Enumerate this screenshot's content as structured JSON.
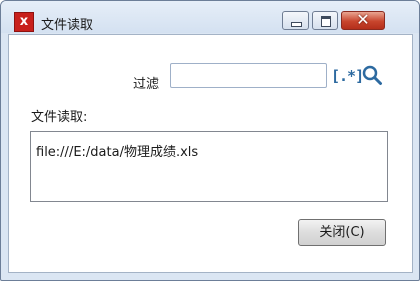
{
  "window": {
    "title": "文件读取",
    "app_icon_glyph": "ⅹ",
    "controls": {
      "minimize": "minimize",
      "maximize": "maximize",
      "close": "✕"
    }
  },
  "filter": {
    "label": "过滤",
    "value": "",
    "regex_icon_text": "[.*]",
    "search_icon": "search-icon"
  },
  "content": {
    "label": "文件读取:",
    "text": "file:///E:/data/物理成绩.xls"
  },
  "buttons": {
    "close_label": "关闭(C)"
  },
  "colors": {
    "titlebar": "#dbe6f3",
    "close_button": "#c8452d",
    "accent": "#2d6aa0"
  }
}
